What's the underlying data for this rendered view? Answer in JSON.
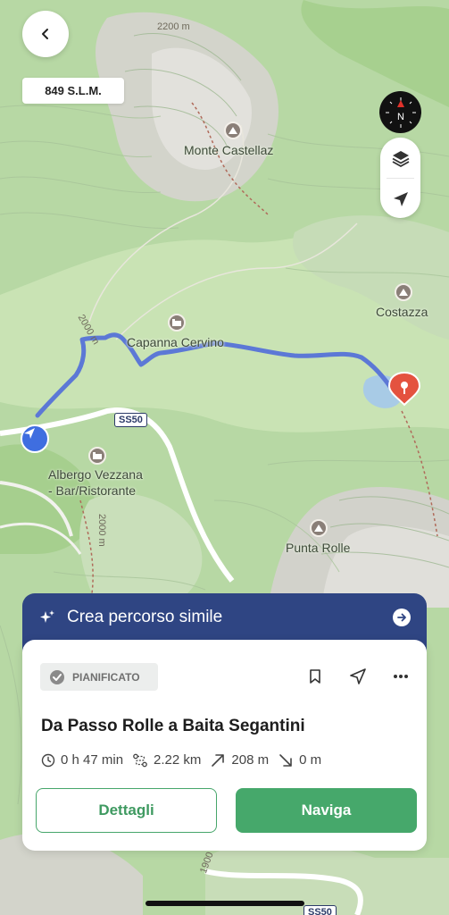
{
  "map": {
    "labels": {
      "monte_castellaz": "Monte Castellaz",
      "costazza": "Costazza",
      "capanna_cervino": "Capanna Cervino",
      "albergo_line1": "Albergo Vezzana",
      "albergo_line2": "- Bar/Ristorante",
      "punta_rolle": "Punta Rolle"
    },
    "contours": {
      "c2200": "2200 m",
      "c2000a": "2000 m",
      "c2000b": "2000 m",
      "c1900": "1900 m"
    },
    "roads": {
      "ss50_a": "SS50",
      "ss50_b": "SS50"
    },
    "route_color": "#5c78d6",
    "destination_color": "#e4523f"
  },
  "altitude": "849 S.L.M.",
  "compass_label": "N",
  "similar": {
    "label": "Crea percorso simile"
  },
  "route": {
    "status": "PIANIFICATO",
    "title": "Da Passo Rolle a Baita Segantini",
    "stats": {
      "duration": "0 h 47 min",
      "distance": "2.22 km",
      "ascent": "208 m",
      "descent": "0 m"
    },
    "details_label": "Dettagli",
    "navigate_label": "Naviga"
  },
  "colors": {
    "accent_green": "#46a86b",
    "banner_blue": "#2f4583"
  }
}
